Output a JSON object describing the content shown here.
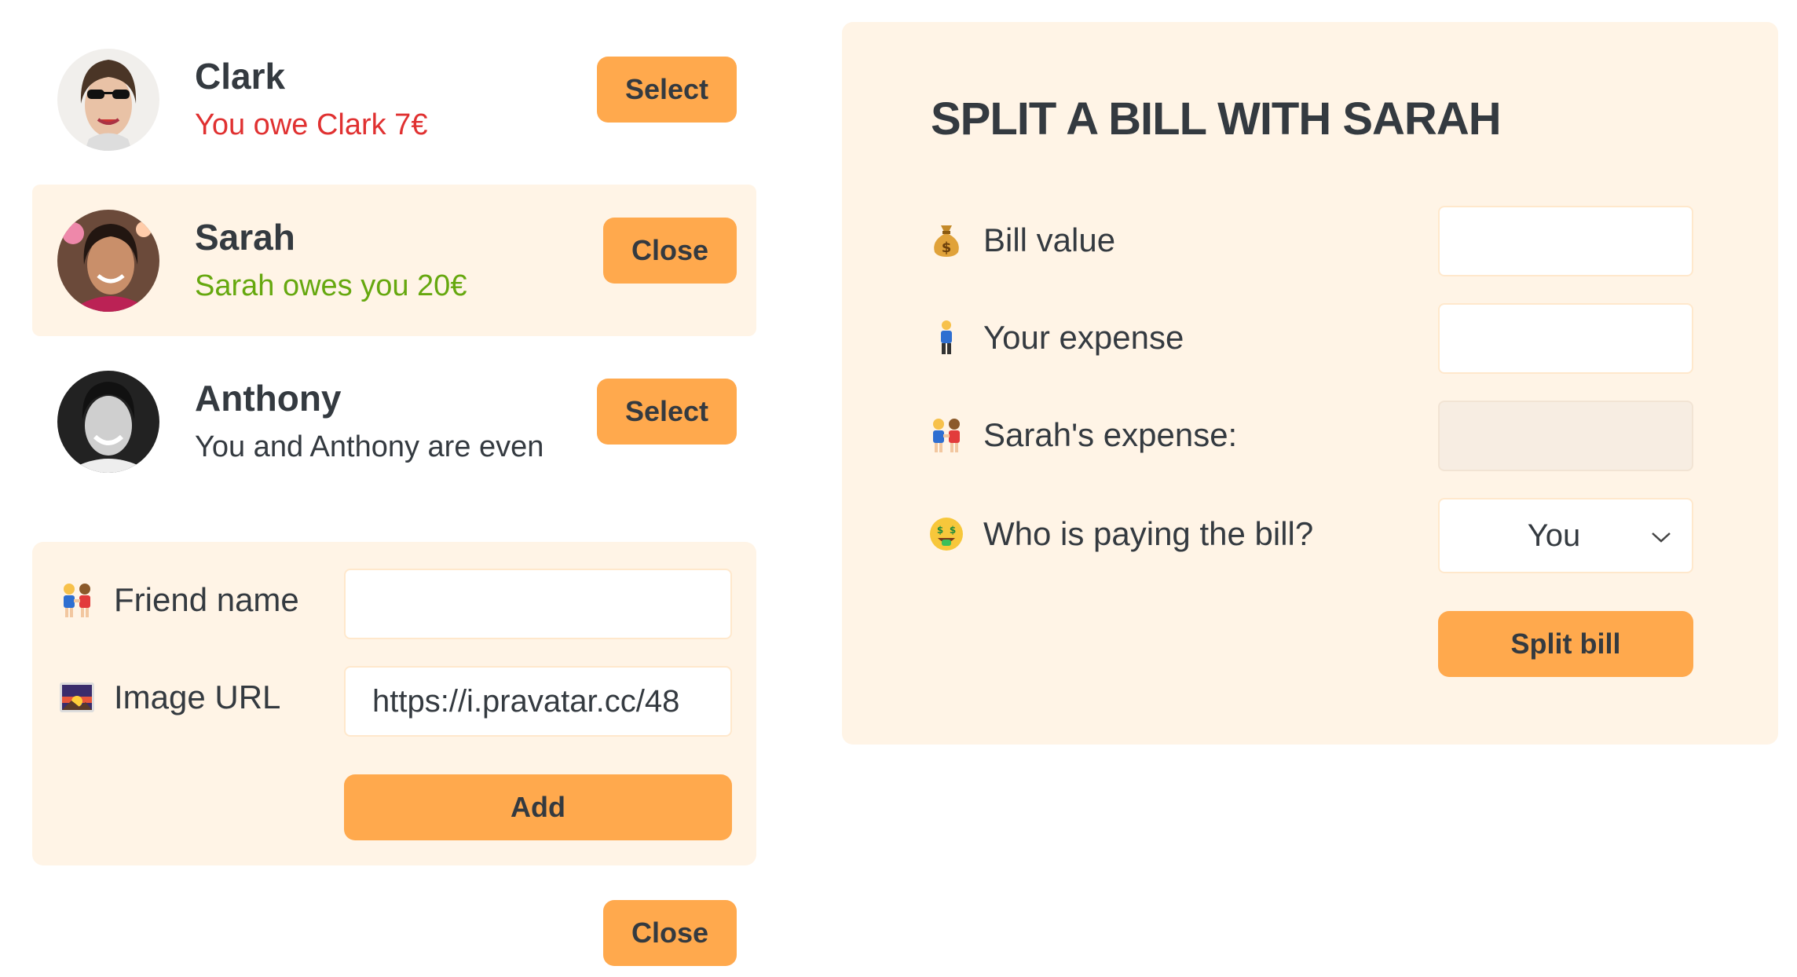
{
  "friends": [
    {
      "name": "Clark",
      "status": "You owe Clark 7€",
      "status_type": "owe",
      "button": "Select",
      "avatar": "avatar-clark"
    },
    {
      "name": "Sarah",
      "status": "Sarah owes you 20€",
      "status_type": "owed",
      "button": "Close",
      "avatar": "avatar-sarah",
      "selected": true
    },
    {
      "name": "Anthony",
      "status": "You and Anthony are even",
      "status_type": "even",
      "button": "Select",
      "avatar": "avatar-anthony"
    }
  ],
  "add_friend": {
    "name_label": "Friend name",
    "name_icon": "people-holding-hands-icon",
    "name_value": "",
    "image_label": "Image URL",
    "image_icon": "sunrise-picture-icon",
    "image_value": "https://i.pravatar.cc/48",
    "submit": "Add"
  },
  "close_form_button": "Close",
  "split": {
    "title": "SPLIT A BILL WITH SARAH",
    "bill_label": "Bill value",
    "bill_icon": "money-bag-icon",
    "bill_value": "",
    "your_label": "Your expense",
    "your_icon": "person-standing-icon",
    "your_value": "",
    "friend_label": "Sarah's expense:",
    "friend_icon": "people-holding-hands-icon",
    "friend_value": "",
    "payer_label": "Who is paying the bill?",
    "payer_icon": "money-mouth-face-icon",
    "payer_selected": "You",
    "submit": "Split bill"
  },
  "colors": {
    "accent": "#ffa94d",
    "panel": "#fff4e6",
    "owe": "#e03131",
    "owed": "#66a80f",
    "text": "#343a40"
  }
}
